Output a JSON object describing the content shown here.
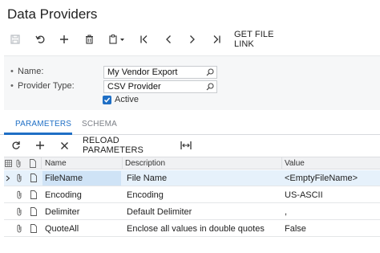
{
  "page": {
    "title": "Data Providers"
  },
  "toolbar": {
    "save_icon": "save-icon",
    "undo_icon": "undo-icon",
    "add_icon": "plus-icon",
    "delete_icon": "trash-icon",
    "copy_icon": "copy-icon",
    "first_icon": "first-record-icon",
    "prev_icon": "previous-icon",
    "next_icon": "next-icon",
    "last_icon": "last-record-icon",
    "file_link_label": "GET FILE LINK"
  },
  "form": {
    "name_label": "Name:",
    "name_value": "My Vendor Export",
    "provider_type_label": "Provider Type:",
    "provider_type_value": "CSV Provider",
    "active_label": "Active",
    "active_checked": true
  },
  "tabs": [
    {
      "label": "PARAMETERS",
      "active": true
    },
    {
      "label": "SCHEMA",
      "active": false
    }
  ],
  "grid_toolbar": {
    "refresh_icon": "refresh-icon",
    "add_icon": "plus-icon",
    "delete_icon": "close-icon",
    "reload_label": "RELOAD PARAMETERS",
    "fit_icon": "fit-columns-icon"
  },
  "table": {
    "columns": [
      "Name",
      "Description",
      "Value"
    ],
    "rows": [
      {
        "name": "FileName",
        "description": "File Name",
        "value": "<EmptyFileName>",
        "selected": true
      },
      {
        "name": "Encoding",
        "description": "Encoding",
        "value": "US-ASCII",
        "selected": false
      },
      {
        "name": "Delimiter",
        "description": "Default Delimiter",
        "value": ",",
        "selected": false
      },
      {
        "name": "QuoteAll",
        "description": "Enclose all values in double quotes",
        "value": "False",
        "selected": false
      }
    ]
  },
  "colors": {
    "accent": "#1f6fc5",
    "selected_row": "#e6f1fb"
  }
}
